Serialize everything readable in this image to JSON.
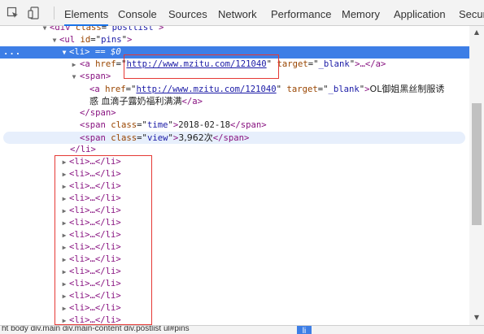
{
  "toolbar": {
    "icons": [
      "inspect-element-icon",
      "device-toolbar-icon"
    ],
    "tabs": [
      {
        "label": "Elements",
        "active": true
      },
      {
        "label": "Console",
        "active": false
      },
      {
        "label": "Sources",
        "active": false
      },
      {
        "label": "Network",
        "active": false
      },
      {
        "label": "Performance",
        "active": false
      },
      {
        "label": "Memory",
        "active": false
      },
      {
        "label": "Application",
        "active": false
      },
      {
        "label": "Securi",
        "active": false
      }
    ]
  },
  "tree": {
    "div_open": {
      "tag_open": "<div",
      "attr": "class",
      "value": "postlist",
      "tag_close": ">"
    },
    "ul_open": {
      "tag_open": "<ul",
      "attr": "id",
      "value": "pins",
      "tag_close": ">"
    },
    "li_selected": {
      "tag": "<li>",
      "eq": " == ",
      "ref": "$0",
      "dots": "..."
    },
    "a1": {
      "tag_open": "<a",
      "href_attr": "href",
      "href": "http://www.mzitu.com/121040",
      "target_attr": "target",
      "target": "_blank",
      "tail": ">…</a>"
    },
    "span_open": "<span>",
    "a2": {
      "tag_open": "<a",
      "href_attr": "href",
      "href": "http://www.mzitu.com/121040",
      "target_attr": "target",
      "target": "_blank",
      "text_line1": "OL御姐黑丝制服诱",
      "text_line2": "惑 血滴子露奶福利满满",
      "tag_close": "</a>"
    },
    "span_close": "</span>",
    "span_time": {
      "tag_open": "<span",
      "attr": "class",
      "value": "time",
      "text": "2018-02-18",
      "tag_close": "</span>"
    },
    "span_view": {
      "tag_open": "<span",
      "attr": "class",
      "value": "view",
      "text": "3,962次",
      "tag_close": "</span>"
    },
    "li_close": "</li>",
    "collapsed_li": "<li>…</li>",
    "collapsed_count": 14
  },
  "breadcrumb": {
    "text": "ht  body  div.main  div.main-content  div.postlist  ul#pins",
    "current": "li"
  }
}
